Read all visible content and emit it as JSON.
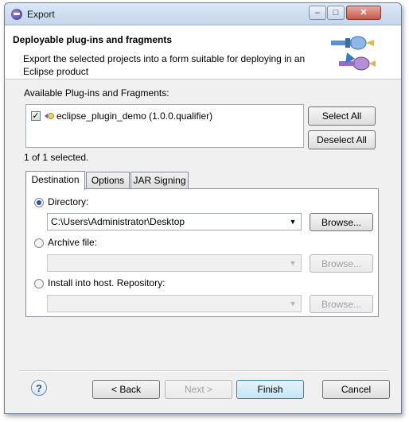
{
  "window": {
    "title": "Export",
    "min_glyph": "–",
    "max_glyph": "□",
    "close_glyph": "✕"
  },
  "banner": {
    "title": "Deployable plug-ins and fragments",
    "description": "Export the selected projects into a form suitable for deploying in an Eclipse product"
  },
  "plugins": {
    "label": "Available Plug-ins and Fragments:",
    "items": [
      {
        "name": "eclipse_plugin_demo (1.0.0.qualifier)",
        "checked": true,
        "check_glyph": "✓"
      }
    ],
    "select_all": "Select All",
    "deselect_all": "Deselect All",
    "count": "1 of 1 selected."
  },
  "tabs": [
    "Destination",
    "Options",
    "JAR Signing"
  ],
  "destination": {
    "directory_label": "Directory:",
    "directory_value": "C:\\Users\\Administrator\\Desktop",
    "archive_label": "Archive file:",
    "archive_value": "",
    "install_label": "Install into host. Repository:",
    "install_value": "",
    "browse": "Browse...",
    "arrow_glyph": "▼"
  },
  "footer": {
    "help_glyph": "?",
    "back": "< Back",
    "next": "Next >",
    "finish": "Finish",
    "cancel": "Cancel"
  }
}
